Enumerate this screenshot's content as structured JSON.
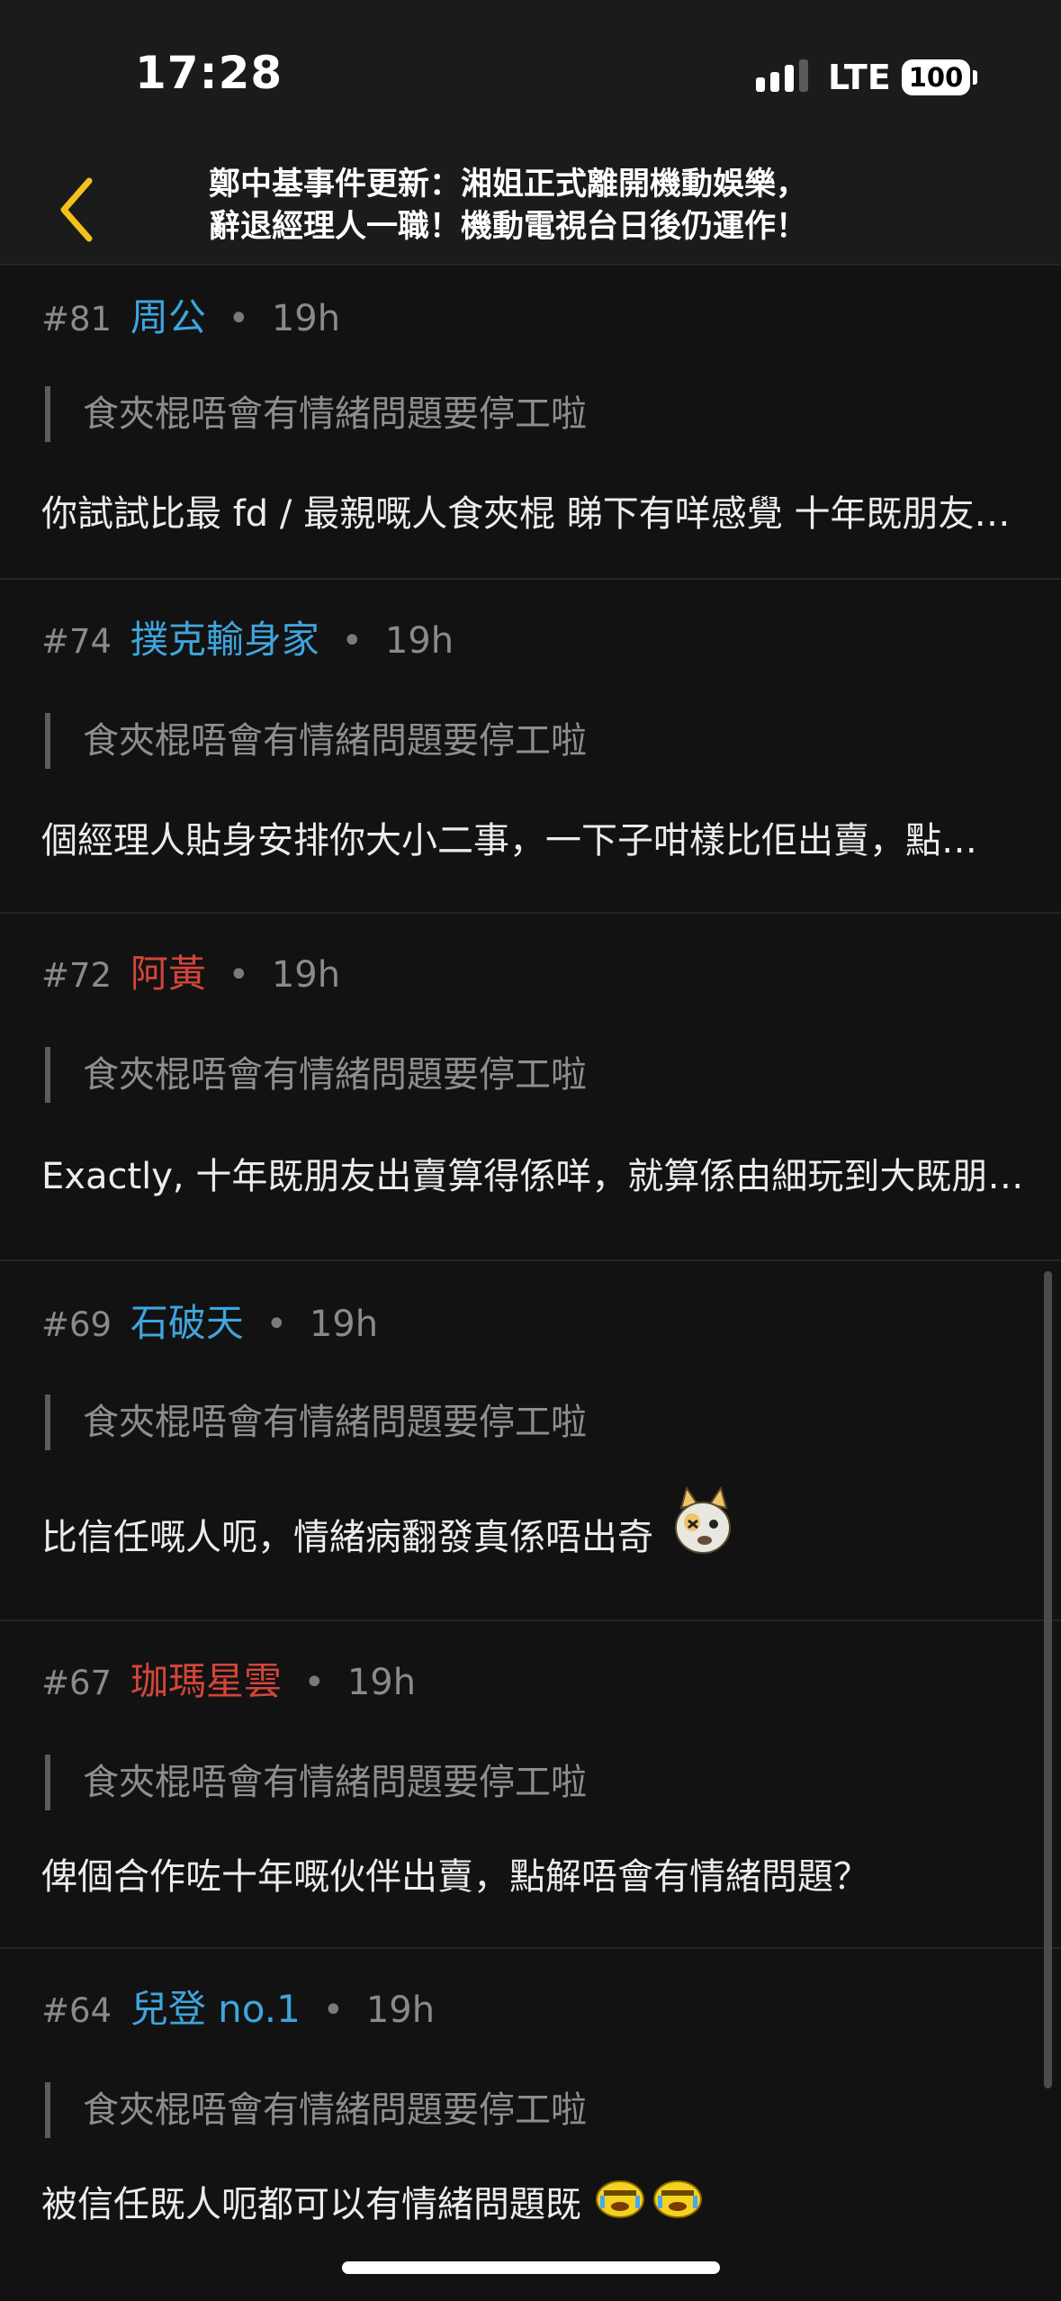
{
  "status_bar": {
    "time": "17:28",
    "network": "LTE",
    "battery": "100"
  },
  "header": {
    "back_icon": "chevron-left-icon",
    "title": "鄭中基事件更新：湘姐正式離開機動娛樂，\n辭退經理人一職！機動電視台日後仍運作！",
    "accent_color": "#f2c21b"
  },
  "replies": [
    {
      "number": "#81",
      "user": "周公",
      "user_color": "blue",
      "time": "19h",
      "quote": "食夾棍唔會有情緒問題要停工啦",
      "body": "你試試比最 fd / 最親嘅人食夾棍 睇下有咩感覺  十年既朋友出賣算得係咩"
    },
    {
      "number": "#74",
      "user": "撲克輸身家",
      "user_color": "blue",
      "time": "19h",
      "quote": "食夾棍唔會有情緒問題要停工啦",
      "body": "個經理人貼身安排你大小二事，一下子咁樣比佢出賣，點解唔會有情緒問題"
    },
    {
      "number": "#72",
      "user": "阿黃",
      "user_color": "red",
      "time": "19h",
      "quote": "食夾棍唔會有情緒問題要停工啦",
      "body": "Exactly, 十年既朋友出賣算得係咩，就算係由細玩到大既朋友都會有情緒問題"
    },
    {
      "number": "#69",
      "user": "石破天",
      "user_color": "blue",
      "time": "19h",
      "quote": "食夾棍唔會有情緒問題要停工啦",
      "body": "比信任嘅人呃，情緒病翻發真係唔出奇",
      "sticker": "dizzy-dog-sticker-icon"
    },
    {
      "number": "#67",
      "user": "珈瑪星雲",
      "user_color": "red",
      "time": "19h",
      "quote": "食夾棍唔會有情緒問題要停工啦",
      "body": "俾個合作咗十年嘅伙伴出賣，點解唔會有情緒問題？"
    },
    {
      "number": "#64",
      "user": "兒登 no.1",
      "user_color": "blue",
      "time": "19h",
      "quote": "食夾棍唔會有情緒問題要停工啦",
      "body": "被信任既人呃都可以有情緒問題既",
      "sticker": "yellow-crying-face-sticker-icon"
    }
  ]
}
